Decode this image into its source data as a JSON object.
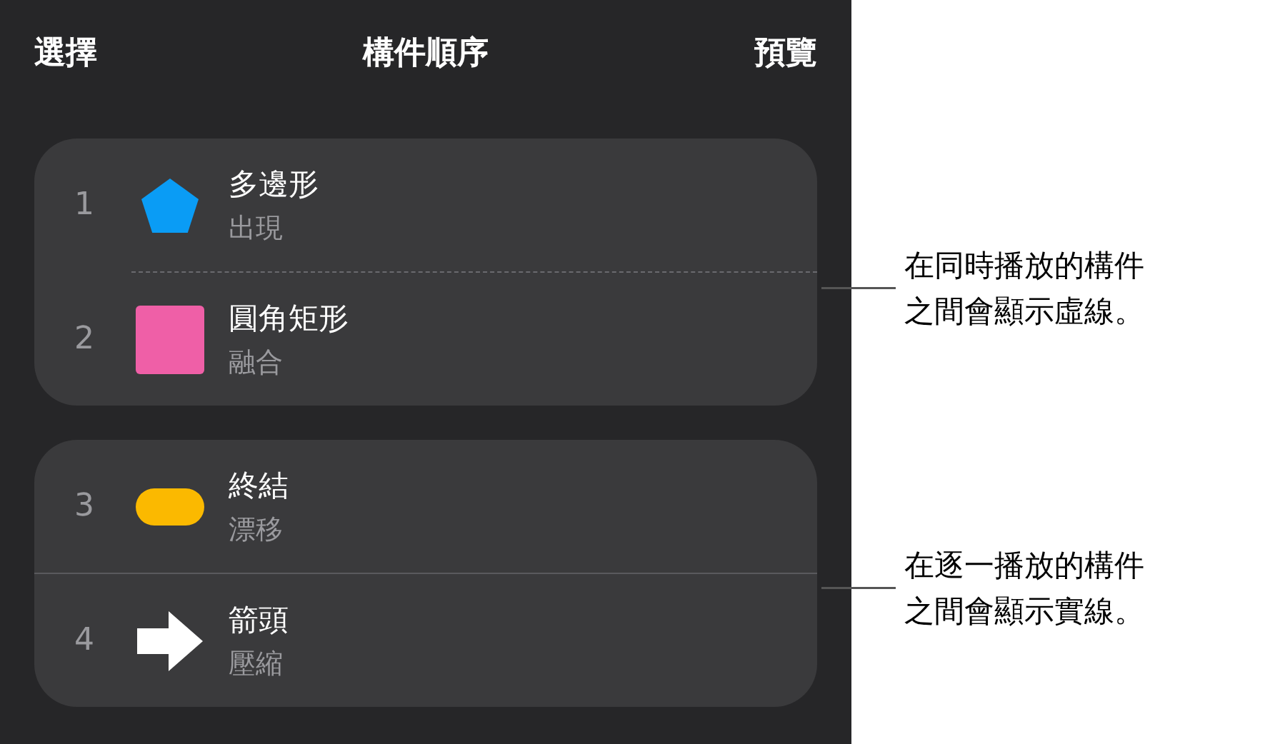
{
  "header": {
    "left": "選擇",
    "title": "構件順序",
    "right": "預覽"
  },
  "groups": [
    {
      "dashed_divider": true,
      "items": [
        {
          "number": "1",
          "name": "多邊形",
          "effect": "出現",
          "kind": "pentagon",
          "color": "#0a9cf5"
        },
        {
          "number": "2",
          "name": "圓角矩形",
          "effect": "融合",
          "kind": "square",
          "color": "#ef5fa7"
        }
      ]
    },
    {
      "dashed_divider": false,
      "items": [
        {
          "number": "3",
          "name": "終結",
          "effect": "漂移",
          "kind": "pill",
          "color": "#fbb900"
        },
        {
          "number": "4",
          "name": "箭頭",
          "effect": "壓縮",
          "kind": "arrow",
          "color": "#ffffff"
        }
      ]
    }
  ],
  "callouts": [
    {
      "text": "在同時播放的構件之間會顯示虛線。"
    },
    {
      "text": "在逐一播放的構件之間會顯示實線。"
    }
  ]
}
